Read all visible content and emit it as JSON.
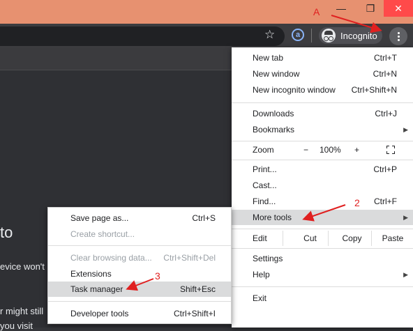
{
  "window": {
    "restore_glyph": "❐",
    "minimize_glyph": "—",
    "close_glyph": "✕"
  },
  "toolbar": {
    "incognito_label": "Incognito",
    "extension_glyph": "a",
    "star_glyph": "☆"
  },
  "page_bg": {
    "title_fragment": "to",
    "line1": "evice won't",
    "line2": "r might still",
    "line3": "you visit"
  },
  "main_menu": {
    "new_tab": {
      "label": "New tab",
      "shortcut": "Ctrl+T"
    },
    "new_window": {
      "label": "New window",
      "shortcut": "Ctrl+N"
    },
    "new_incognito": {
      "label": "New incognito window",
      "shortcut": "Ctrl+Shift+N"
    },
    "downloads": {
      "label": "Downloads",
      "shortcut": "Ctrl+J"
    },
    "bookmarks": {
      "label": "Bookmarks"
    },
    "zoom": {
      "label": "Zoom",
      "minus": "−",
      "value": "100%",
      "plus": "+"
    },
    "print": {
      "label": "Print...",
      "shortcut": "Ctrl+P"
    },
    "cast": {
      "label": "Cast..."
    },
    "find": {
      "label": "Find...",
      "shortcut": "Ctrl+F"
    },
    "more_tools": {
      "label": "More tools"
    },
    "edit": {
      "label": "Edit",
      "cut": "Cut",
      "copy": "Copy",
      "paste": "Paste"
    },
    "settings": {
      "label": "Settings"
    },
    "help": {
      "label": "Help"
    },
    "exit": {
      "label": "Exit"
    }
  },
  "sub_menu": {
    "save_page": {
      "label": "Save page as...",
      "shortcut": "Ctrl+S"
    },
    "create_shortcut": {
      "label": "Create shortcut..."
    },
    "clear_browsing": {
      "label": "Clear browsing data...",
      "shortcut": "Ctrl+Shift+Del"
    },
    "extensions": {
      "label": "Extensions"
    },
    "task_manager": {
      "label": "Task manager",
      "shortcut": "Shift+Esc"
    },
    "developer_tools": {
      "label": "Developer tools",
      "shortcut": "Ctrl+Shift+I"
    }
  },
  "annotations": {
    "a": "A",
    "two": "2",
    "three": "3",
    "color": "#e02020"
  }
}
